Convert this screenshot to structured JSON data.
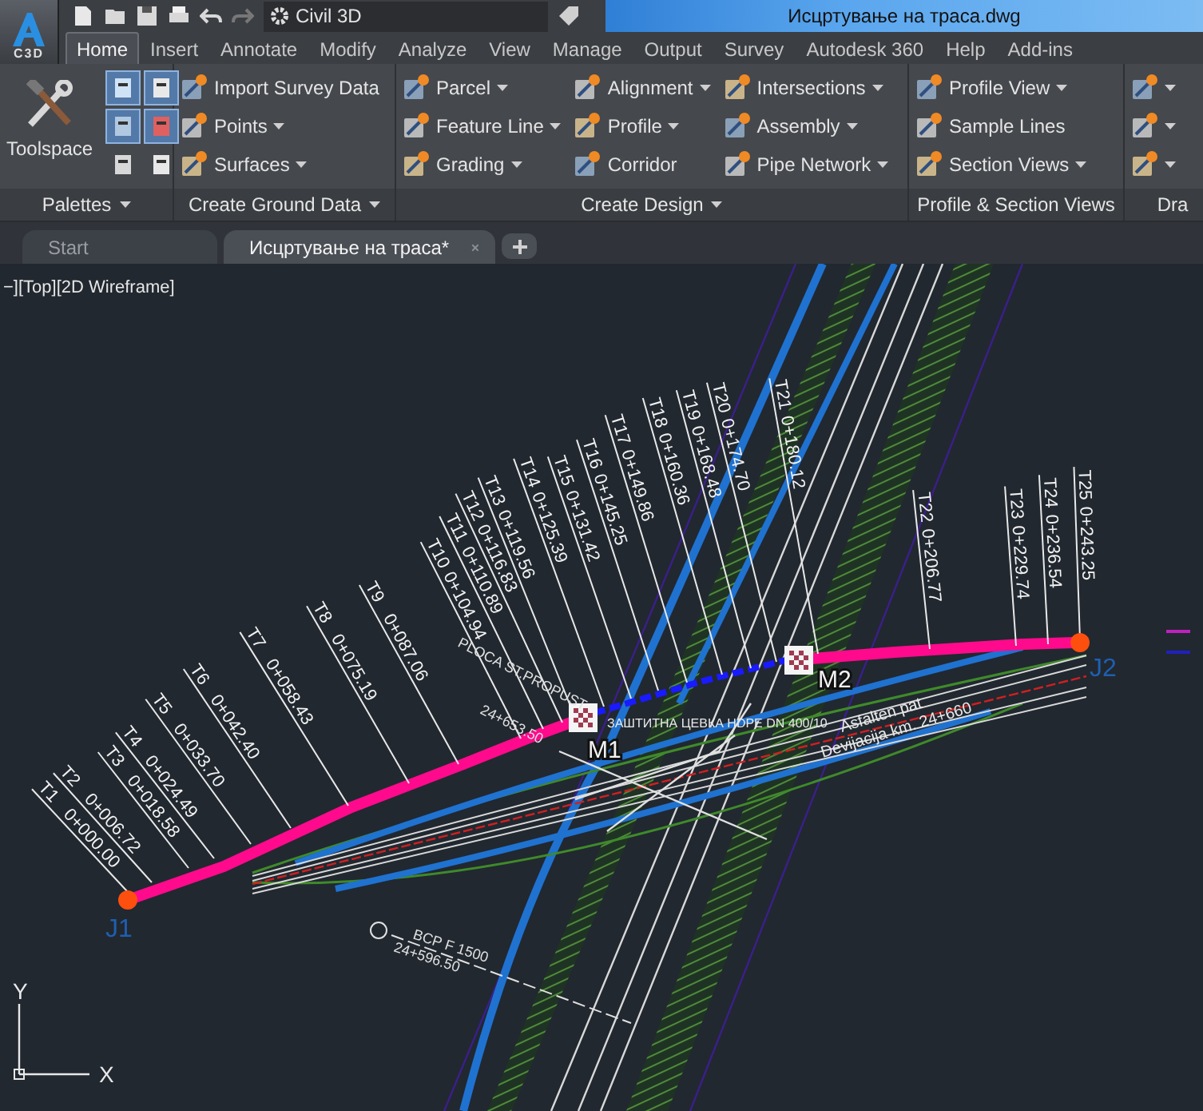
{
  "app_menu": {
    "label": "C3D"
  },
  "workspace": {
    "value": "Civil 3D"
  },
  "document_title": "Исцртување на траса.dwg",
  "ribbon_tabs": [
    {
      "label": "Home",
      "selected": true
    },
    {
      "label": "Insert",
      "selected": false
    },
    {
      "label": "Annotate",
      "selected": false
    },
    {
      "label": "Modify",
      "selected": false
    },
    {
      "label": "Analyze",
      "selected": false
    },
    {
      "label": "View",
      "selected": false
    },
    {
      "label": "Manage",
      "selected": false
    },
    {
      "label": "Output",
      "selected": false
    },
    {
      "label": "Survey",
      "selected": false
    },
    {
      "label": "Autodesk 360",
      "selected": false
    },
    {
      "label": "Help",
      "selected": false
    },
    {
      "label": "Add-ins",
      "selected": false
    }
  ],
  "ribbon_panels": [
    {
      "kind": "palettes",
      "title": "Palettes",
      "menu": true,
      "large_tool": "Toolspace",
      "toggles": [
        {
          "on": true
        },
        {
          "on": true
        },
        {
          "on": true
        },
        {
          "on": true
        },
        {
          "on": false
        },
        {
          "on": false
        }
      ]
    },
    {
      "kind": "tools",
      "title": "Create Ground Data",
      "menu": true,
      "columns": [
        [
          {
            "label": "Import Survey Data",
            "dropdown": false
          },
          {
            "label": "Points",
            "dropdown": true
          },
          {
            "label": "Surfaces",
            "dropdown": true
          }
        ]
      ]
    },
    {
      "kind": "tools",
      "title": "Create Design",
      "menu": true,
      "columns": [
        [
          {
            "label": "Parcel",
            "dropdown": true
          },
          {
            "label": "Feature Line",
            "dropdown": true
          },
          {
            "label": "Grading",
            "dropdown": true
          }
        ],
        [
          {
            "label": "Alignment",
            "dropdown": true
          },
          {
            "label": "Profile",
            "dropdown": true
          },
          {
            "label": "Corridor",
            "dropdown": false
          }
        ],
        [
          {
            "label": "Intersections",
            "dropdown": true
          },
          {
            "label": "Assembly",
            "dropdown": true
          },
          {
            "label": "Pipe Network",
            "dropdown": true
          }
        ]
      ]
    },
    {
      "kind": "tools",
      "title": "Profile & Section Views",
      "menu": false,
      "columns": [
        [
          {
            "label": "Profile View",
            "dropdown": true
          },
          {
            "label": "Sample Lines",
            "dropdown": false
          },
          {
            "label": "Section Views",
            "dropdown": true
          }
        ]
      ]
    },
    {
      "kind": "tools",
      "title": "Dra",
      "menu": false,
      "columns": [
        [
          {
            "dropdown": true
          },
          {
            "dropdown": true
          },
          {
            "dropdown": true
          }
        ]
      ]
    }
  ],
  "file_tabs": [
    {
      "label": "Start",
      "selected": false,
      "closable": false
    },
    {
      "label": "Исцртување на траса*",
      "selected": true,
      "closable": true
    }
  ],
  "viewport": {
    "label": "−][Top][2D Wireframe]",
    "alignment": {
      "start": "J1",
      "end": "J2",
      "markers": [
        "M1",
        "M2"
      ],
      "stations": [
        {
          "name": "T1",
          "station": "0+000.00"
        },
        {
          "name": "T2",
          "station": "0+006.72"
        },
        {
          "name": "T3",
          "station": "0+018.58"
        },
        {
          "name": "T4",
          "station": "0+024.49"
        },
        {
          "name": "T5",
          "station": "0+033.70"
        },
        {
          "name": "T6",
          "station": "0+042.40"
        },
        {
          "name": "T7",
          "station": "0+058.43"
        },
        {
          "name": "T8",
          "station": "0+075.19"
        },
        {
          "name": "T9",
          "station": "0+087.06"
        },
        {
          "name": "T10",
          "station": "0+104.94"
        },
        {
          "name": "T11",
          "station": "0+110.89"
        },
        {
          "name": "T12",
          "station": "0+116.83"
        },
        {
          "name": "T13",
          "station": "0+119.56"
        },
        {
          "name": "T14",
          "station": "0+125.39"
        },
        {
          "name": "T15",
          "station": "0+131.42"
        },
        {
          "name": "T16",
          "station": "0+145.25"
        },
        {
          "name": "T17",
          "station": "0+149.86"
        },
        {
          "name": "T18",
          "station": "0+160.36"
        },
        {
          "name": "T19",
          "station": "0+168.48"
        },
        {
          "name": "T20",
          "station": "0+174.70"
        },
        {
          "name": "T21",
          "station": "0+180.12"
        },
        {
          "name": "T22",
          "station": "0+206.77"
        },
        {
          "name": "T23",
          "station": "0+229.74"
        },
        {
          "name": "T24",
          "station": "0+236.54"
        },
        {
          "name": "T25",
          "station": "0+243.25"
        }
      ]
    },
    "annotations": [
      "PLOCA ST.PROPUST",
      "24+653.50",
      "ЗАШТИТНА ЦЕВКА HDPE DN 400/10",
      "Asfalten pat",
      "Devijacija km. 24+660",
      "BCP F 1500",
      "24+596.50"
    ],
    "ucs": {
      "y": "Y",
      "x": "X"
    }
  }
}
